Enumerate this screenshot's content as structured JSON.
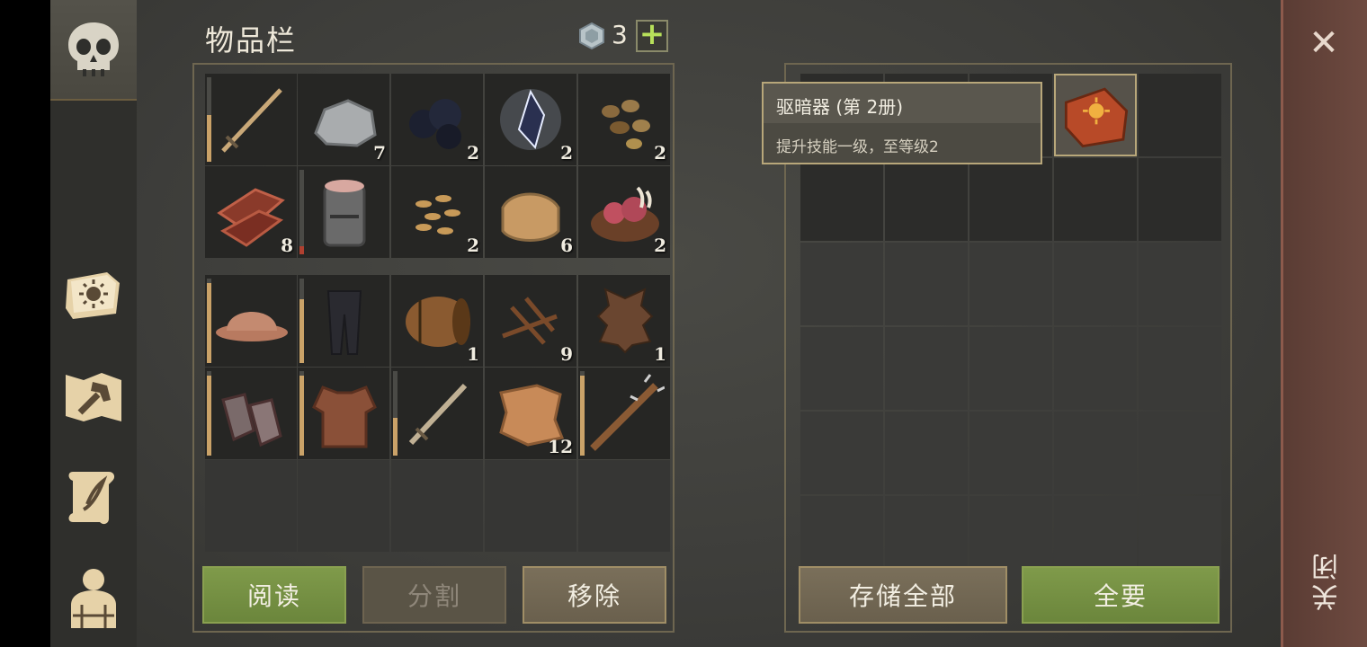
{
  "inventory": {
    "title": "物品栏",
    "gem_count": "3",
    "plus_label": "+",
    "slots": [
      {
        "item": "sword",
        "count": "",
        "durability": 0.55
      },
      {
        "item": "stone",
        "count": "7"
      },
      {
        "item": "coal",
        "count": "2"
      },
      {
        "item": "crystal",
        "count": "2"
      },
      {
        "item": "pebbles",
        "count": "2"
      },
      {
        "item": "meat",
        "count": "8"
      },
      {
        "item": "helmet-great",
        "count": "",
        "durability": 0.1,
        "durability_low": true
      },
      {
        "item": "seeds",
        "count": "2"
      },
      {
        "item": "cloth",
        "count": "6"
      },
      {
        "item": "raw-meat-bowl",
        "count": "2"
      },
      {
        "item": "hat-helmet",
        "count": "",
        "durability": 0.95
      },
      {
        "item": "leggings",
        "count": "",
        "durability": 0.75
      },
      {
        "item": "barrel",
        "count": "1"
      },
      {
        "item": "nails",
        "count": "9"
      },
      {
        "item": "leather-hide",
        "count": "1"
      },
      {
        "item": "chain-gloves",
        "count": "",
        "durability": 0.95
      },
      {
        "item": "padded-armor",
        "count": "",
        "durability": 0.95
      },
      {
        "item": "short-sword",
        "count": "",
        "durability": 0.45
      },
      {
        "item": "rags",
        "count": "12"
      },
      {
        "item": "spiked-club",
        "count": "",
        "durability": 0.95
      }
    ]
  },
  "tooltip": {
    "title": "驱暗器 (第 2册)",
    "description": "提升技能一级，至等级2"
  },
  "buttons": {
    "read": "阅读",
    "split": "分割",
    "remove": "移除",
    "store_all": "存储全部",
    "take_all": "全要"
  },
  "close": {
    "label": "关闭",
    "icon": "close-icon"
  },
  "sidebar": {
    "items": [
      {
        "icon": "skull-icon"
      },
      {
        "icon": "sun-book-icon"
      },
      {
        "icon": "crafting-hammer-icon"
      },
      {
        "icon": "quest-scroll-icon"
      },
      {
        "icon": "character-icon"
      }
    ]
  },
  "colors": {
    "accent_green": "#7f9a4a",
    "panel_border": "#6e6650",
    "close_bar": "#6e4a40"
  }
}
